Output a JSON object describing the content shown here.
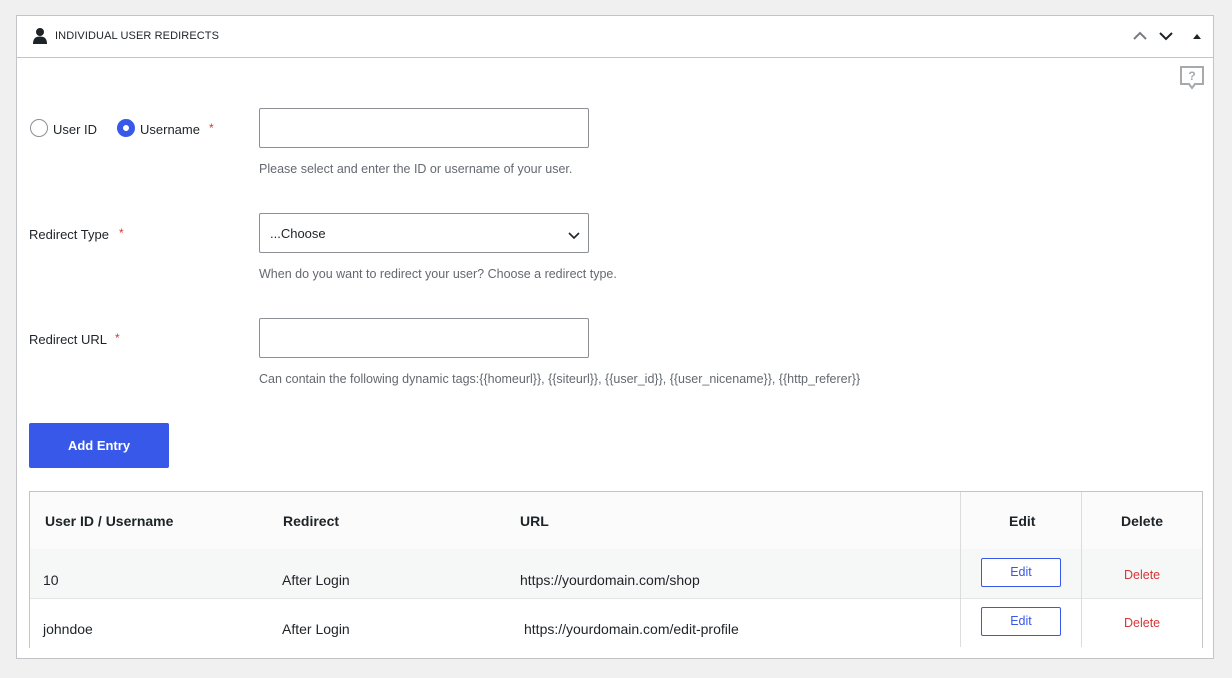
{
  "panel": {
    "title": "INDIVIDUAL USER REDIRECTS",
    "icons": [
      "user-icon",
      "chevron-up-icon",
      "chevron-down-icon",
      "collapse-triangle-icon",
      "help-icon"
    ]
  },
  "form": {
    "radio_user_id_label": "User ID",
    "radio_username_label": "Username",
    "selected_radio": "Username",
    "required_mark": "*",
    "user_input_value": "",
    "user_help": "Please select and enter the ID or username of your user.",
    "redirect_type_label": "Redirect Type",
    "redirect_type_selected": "...Choose",
    "redirect_type_help": "When do you want to redirect your user? Choose a redirect type.",
    "redirect_url_label": "Redirect URL",
    "redirect_url_value": "",
    "redirect_url_help": "Can contain the following dynamic tags:{{homeurl}}, {{siteurl}}, {{user_id}}, {{user_nicename}}, {{http_referer}}",
    "add_entry_label": "Add Entry"
  },
  "table": {
    "headers": [
      "User ID / Username",
      "Redirect",
      "URL",
      "Edit",
      "Delete"
    ],
    "rows": [
      {
        "user": "10",
        "redirect": "After Login",
        "url": "https://yourdomain.com/shop",
        "edit": "Edit",
        "delete": "Delete"
      },
      {
        "user": "johndoe",
        "redirect": "After Login",
        "url": "https://yourdomain.com/edit-profile",
        "edit": "Edit",
        "delete": "Delete"
      }
    ]
  },
  "colors": {
    "accent": "#3858e9",
    "danger": "#d63638",
    "border": "#c3c4c7",
    "muted_text": "#646970"
  }
}
